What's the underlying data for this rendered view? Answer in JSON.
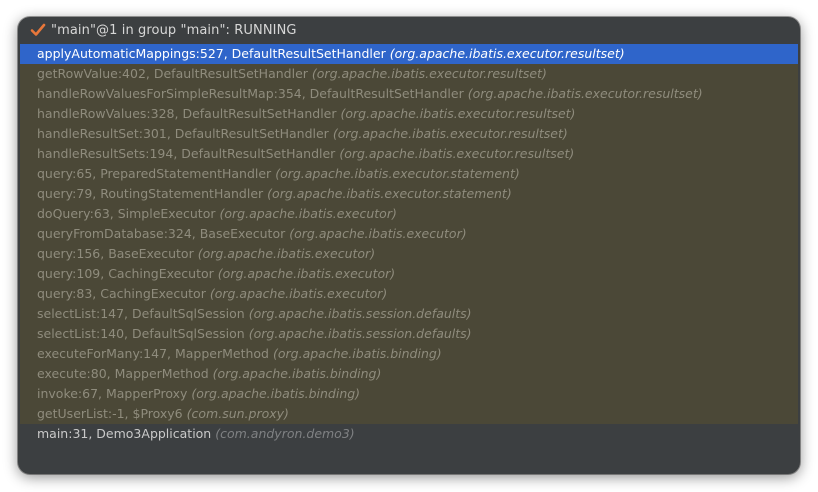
{
  "header": {
    "icon": "checkmark-icon",
    "title": "\"main\"@1 in group \"main\": RUNNING",
    "icon_color": "#e8773a"
  },
  "colors": {
    "background": "#3c3f41",
    "library_frame_bg": "#4b4837",
    "selected_frame_bg": "#2f65ca"
  },
  "frames": [
    {
      "method": "applyAutomaticMappings:527, DefaultResultSetHandler",
      "package": "(org.apache.ibatis.executor.resultset)",
      "kind": "selected"
    },
    {
      "method": "getRowValue:402, DefaultResultSetHandler",
      "package": "(org.apache.ibatis.executor.resultset)",
      "kind": "lib"
    },
    {
      "method": "handleRowValuesForSimpleResultMap:354, DefaultResultSetHandler",
      "package": "(org.apache.ibatis.executor.resultset)",
      "kind": "lib"
    },
    {
      "method": "handleRowValues:328, DefaultResultSetHandler",
      "package": "(org.apache.ibatis.executor.resultset)",
      "kind": "lib"
    },
    {
      "method": "handleResultSet:301, DefaultResultSetHandler",
      "package": "(org.apache.ibatis.executor.resultset)",
      "kind": "lib"
    },
    {
      "method": "handleResultSets:194, DefaultResultSetHandler",
      "package": "(org.apache.ibatis.executor.resultset)",
      "kind": "lib"
    },
    {
      "method": "query:65, PreparedStatementHandler",
      "package": "(org.apache.ibatis.executor.statement)",
      "kind": "lib"
    },
    {
      "method": "query:79, RoutingStatementHandler",
      "package": "(org.apache.ibatis.executor.statement)",
      "kind": "lib"
    },
    {
      "method": "doQuery:63, SimpleExecutor",
      "package": "(org.apache.ibatis.executor)",
      "kind": "lib"
    },
    {
      "method": "queryFromDatabase:324, BaseExecutor",
      "package": "(org.apache.ibatis.executor)",
      "kind": "lib"
    },
    {
      "method": "query:156, BaseExecutor",
      "package": "(org.apache.ibatis.executor)",
      "kind": "lib"
    },
    {
      "method": "query:109, CachingExecutor",
      "package": "(org.apache.ibatis.executor)",
      "kind": "lib"
    },
    {
      "method": "query:83, CachingExecutor",
      "package": "(org.apache.ibatis.executor)",
      "kind": "lib"
    },
    {
      "method": "selectList:147, DefaultSqlSession",
      "package": "(org.apache.ibatis.session.defaults)",
      "kind": "lib"
    },
    {
      "method": "selectList:140, DefaultSqlSession",
      "package": "(org.apache.ibatis.session.defaults)",
      "kind": "lib"
    },
    {
      "method": "executeForMany:147, MapperMethod",
      "package": "(org.apache.ibatis.binding)",
      "kind": "lib"
    },
    {
      "method": "execute:80, MapperMethod",
      "package": "(org.apache.ibatis.binding)",
      "kind": "lib"
    },
    {
      "method": "invoke:67, MapperProxy",
      "package": "(org.apache.ibatis.binding)",
      "kind": "lib"
    },
    {
      "method": "getUserList:-1, $Proxy6",
      "package": "(com.sun.proxy)",
      "kind": "lib"
    },
    {
      "method": "main:31, Demo3Application",
      "package": "(com.andyron.demo3)",
      "kind": "user"
    }
  ]
}
